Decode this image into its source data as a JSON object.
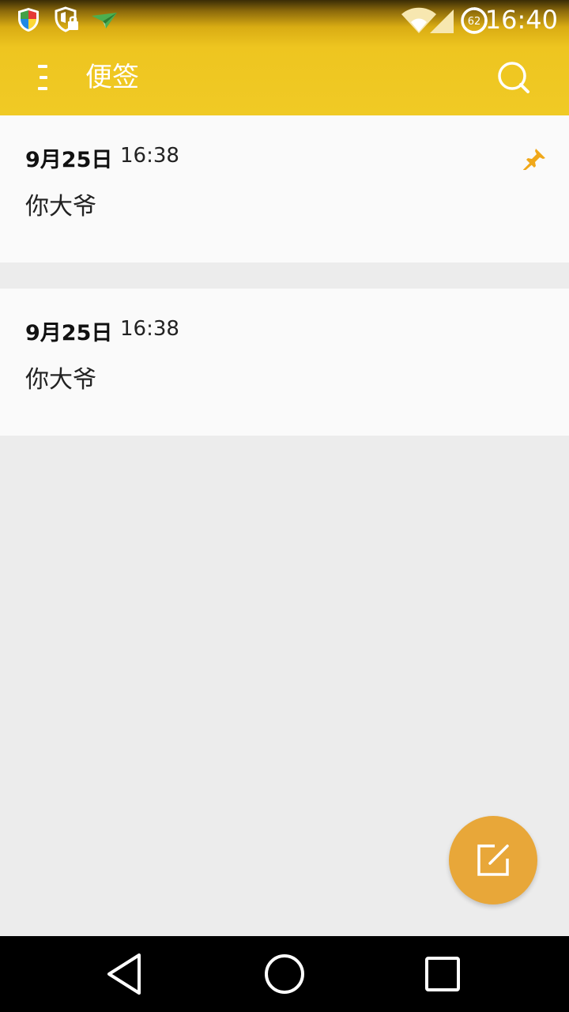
{
  "status_bar": {
    "time": "16:40",
    "battery_level": "62",
    "icons": [
      "shield-icon",
      "security-lock-icon",
      "paper-plane-icon",
      "wifi-icon",
      "signal-icon",
      "battery-icon"
    ]
  },
  "app_bar": {
    "title": "便签",
    "menu_icon": "menu-icon",
    "search_icon": "search-icon"
  },
  "notes": [
    {
      "date": "9月25日",
      "time": "16:38",
      "text": "你大爷",
      "pinned": true
    },
    {
      "date": "9月25日",
      "time": "16:38",
      "text": "你大爷",
      "pinned": false
    }
  ],
  "fab": {
    "icon": "edit-note-icon"
  },
  "navigation": {
    "icons": [
      "back-icon",
      "home-icon",
      "recents-icon"
    ]
  },
  "colors": {
    "accent": "#f0ca25",
    "fab": "#e8a739",
    "pin": "#f0a81a",
    "background": "#ececec",
    "card": "#fafafa"
  }
}
